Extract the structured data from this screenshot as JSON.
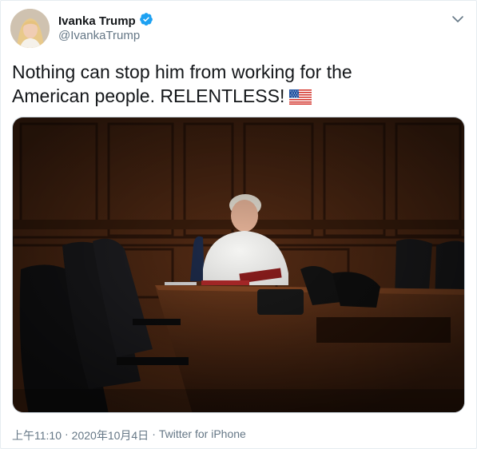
{
  "author": {
    "display_name": "Ivanka Trump",
    "handle": "@IvankaTrump",
    "verified": true
  },
  "tweet": {
    "text_line1": "Nothing can stop him from working for the",
    "text_line2": "American people. RELENTLESS!",
    "emoji": "us-flag"
  },
  "meta": {
    "time": "上午11:10",
    "separator1": "·",
    "date": "2020年10月4日",
    "separator2": "·",
    "source": "Twitter for iPhone"
  },
  "colors": {
    "verified_blue": "#1da1f2",
    "text": "#14171a",
    "secondary": "#657786"
  },
  "icons": {
    "menu": "chevron-down-icon",
    "verified": "verified-badge-icon"
  }
}
